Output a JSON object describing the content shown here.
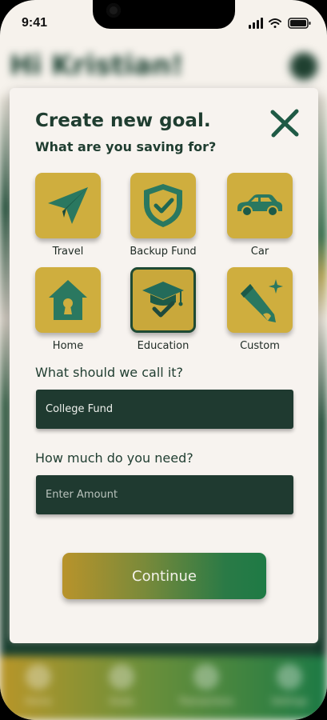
{
  "status_bar": {
    "time": "9:41"
  },
  "background": {
    "greeting": "Hi Kristian!",
    "tabs": [
      "Home",
      "Goals",
      "Transactions",
      "Settings"
    ]
  },
  "modal": {
    "title": "Create new goal.",
    "subtitle": "What are you saving for?",
    "categories": [
      {
        "label": "Travel",
        "icon": "paper-plane-icon"
      },
      {
        "label": "Backup Fund",
        "icon": "shield-check-icon"
      },
      {
        "label": "Car",
        "icon": "car-icon"
      },
      {
        "label": "Home",
        "icon": "house-icon"
      },
      {
        "label": "Education",
        "icon": "graduation-cap-icon",
        "selected": true
      },
      {
        "label": "Custom",
        "icon": "pencil-sparkle-icon"
      }
    ],
    "name_field": {
      "label": "What should we call it?",
      "value": "College Fund"
    },
    "amount_field": {
      "label": "How much do you need?",
      "placeholder": "Enter Amount",
      "value": ""
    },
    "continue_label": "Continue"
  },
  "colors": {
    "accent_gold": "#cfae3e",
    "dark_green": "#1f3a30",
    "title_green": "#1f3d30",
    "icon_teal": "#236b5a"
  }
}
